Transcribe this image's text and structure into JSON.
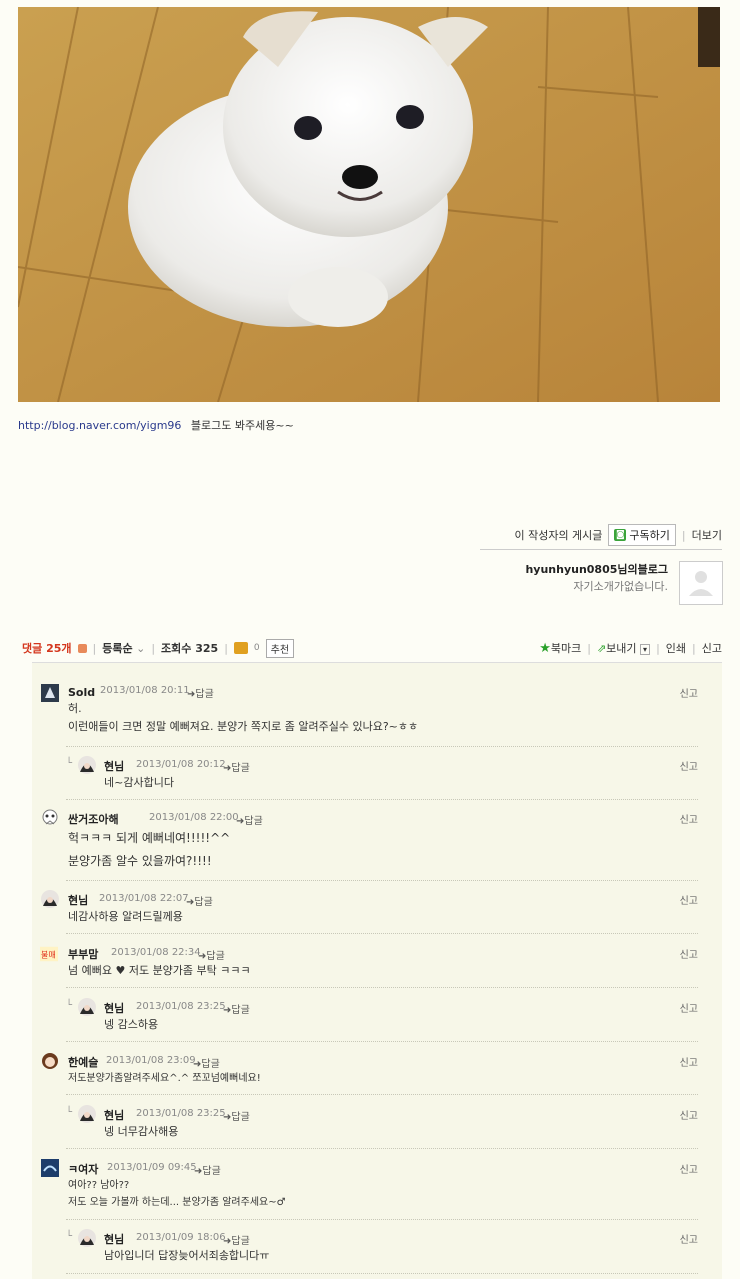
{
  "caption": {
    "link": "http://blog.naver.com/yigm96",
    "text": "블로그도 봐주세용~~"
  },
  "author": {
    "posts_label": "이 작성자의 게시글",
    "subscribe_label": "구독하기",
    "more_label": "더보기",
    "blog_name": "hyunhyun0805님의블로그",
    "intro": "자기소개가없습니다."
  },
  "comment_bar": {
    "count_label": "댓글 25개",
    "sort_label": "등록순",
    "views_label": "조회수 325",
    "likes": "0",
    "recommend_label": "추천",
    "bookmark_label": "북마크",
    "send_label": "보내기",
    "print_label": "인쇄",
    "report_label": "신고"
  },
  "comments": [
    {
      "name": "Sold",
      "date": "2013/01/08 20:11",
      "reply": "답글",
      "report": "신고",
      "body": "허.\n이런애들이 크면 정말 예뻐져요. 분양가 쪽지로 좀 알려주실수 있나요?~ㅎㅎ"
    },
    {
      "name": "현님",
      "date": "2013/01/08 20:12",
      "reply": "답글",
      "report": "신고",
      "body": "네~감사합니다"
    },
    {
      "name": "싼거조아해",
      "date": "2013/01/08 22:00",
      "reply": "답글",
      "report": "신고",
      "body": "헉ㅋㅋㅋ 되게 예뻐네여!!!!!^^\n분양가좀 알수 있을까여?!!!!"
    },
    {
      "name": "현님",
      "date": "2013/01/08 22:07",
      "reply": "답글",
      "report": "신고",
      "body": "네감사하용 알려드릴께용"
    },
    {
      "name": "부부맘",
      "date": "2013/01/08 22:34",
      "reply": "답글",
      "report": "신고",
      "body": "넘 예뻐요 ♥ 저도 분양가좀 부탁 ㅋㅋㅋ"
    },
    {
      "name": "현님",
      "date": "2013/01/08 23:25",
      "reply": "답글",
      "report": "신고",
      "body": "넹 감스하용"
    },
    {
      "name": "한예슬",
      "date": "2013/01/08 23:09",
      "reply": "답글",
      "report": "신고",
      "body": "저도분양가좀알려주세요^.^ 쪼꼬넘예뻐네요!"
    },
    {
      "name": "현님",
      "date": "2013/01/08 23:25",
      "reply": "답글",
      "report": "신고",
      "body": "넹 너무감사해용"
    },
    {
      "name": "ㅋ여자",
      "date": "2013/01/09 09:45",
      "reply": "답글",
      "report": "신고",
      "body": "여아?? 남아??\n저도 오늘 가볼까 하는데... 분양가좀 알려주세요~♂"
    },
    {
      "name": "현님",
      "date": "2013/01/09 18:06",
      "reply": "답글",
      "report": "신고",
      "body": "남아입니더 답장늦어서죄송합니다ㅠ"
    }
  ]
}
